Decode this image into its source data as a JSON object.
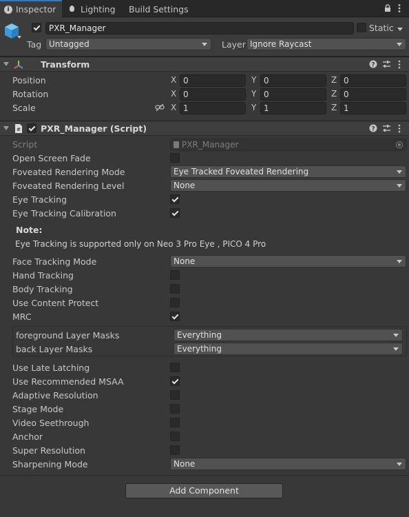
{
  "tabs": [
    {
      "label": "Inspector",
      "icon": "info-icon",
      "active": true
    },
    {
      "label": "Lighting",
      "icon": "bulb-icon",
      "active": false
    },
    {
      "label": "Build Settings",
      "icon": "",
      "active": false
    }
  ],
  "object": {
    "name": "PXR_Manager",
    "active_checked": true,
    "static_label": "Static",
    "tag_label": "Tag",
    "tag_value": "Untagged",
    "layer_label": "Layer",
    "layer_value": "Ignore Raycast"
  },
  "transform": {
    "title": "Transform",
    "rows": [
      {
        "label": "Position",
        "x": "0",
        "y": "0",
        "z": "0"
      },
      {
        "label": "Rotation",
        "x": "0",
        "y": "0",
        "z": "0"
      },
      {
        "label": "Scale",
        "x": "1",
        "y": "1",
        "z": "1"
      }
    ],
    "axes": {
      "x": "X",
      "y": "Y",
      "z": "Z"
    }
  },
  "script_component": {
    "title": "PXR_Manager (Script)",
    "script_label": "Script",
    "script_value": "PXR_Manager",
    "open_screen_fade": {
      "label": "Open Screen Fade",
      "checked": false
    },
    "foveated_mode": {
      "label": "Foveated Rendering Mode",
      "value": "Eye Tracked Foveated Rendering"
    },
    "foveated_level": {
      "label": "Foveated Rendering Level",
      "value": "None"
    },
    "eye_tracking": {
      "label": "Eye Tracking",
      "checked": true
    },
    "eye_tracking_calibration": {
      "label": "Eye Tracking Calibration",
      "checked": true
    },
    "note_title": "Note:",
    "note_text": "Eye Tracking is supported only on Neo 3 Pro Eye , PICO 4 Pro",
    "face_tracking": {
      "label": "Face Tracking Mode",
      "value": "None"
    },
    "hand_tracking": {
      "label": "Hand Tracking",
      "checked": false
    },
    "body_tracking": {
      "label": "Body Tracking",
      "checked": false
    },
    "content_protect": {
      "label": "Use Content Protect",
      "checked": false
    },
    "mrc": {
      "label": "MRC",
      "checked": true
    },
    "foreground_masks": {
      "label": "foreground Layer Masks",
      "value": "Everything"
    },
    "back_masks": {
      "label": "back Layer Masks",
      "value": "Everything"
    },
    "late_latching": {
      "label": "Use Late Latching",
      "checked": false
    },
    "recommended_msaa": {
      "label": "Use Recommended MSAA",
      "checked": true
    },
    "adaptive_resolution": {
      "label": "Adaptive Resolution",
      "checked": false
    },
    "stage_mode": {
      "label": "Stage Mode",
      "checked": false
    },
    "video_seethrough": {
      "label": "Video Seethrough",
      "checked": false
    },
    "anchor": {
      "label": "Anchor",
      "checked": false
    },
    "super_resolution": {
      "label": "Super Resolution",
      "checked": false
    },
    "sharpening_mode": {
      "label": "Sharpening Mode",
      "value": "None"
    }
  },
  "add_component_label": "Add Component",
  "colors": {
    "accent": "#3a79bb",
    "background": "#383838",
    "field": "#2a2a2a",
    "dropdown": "#515151"
  }
}
